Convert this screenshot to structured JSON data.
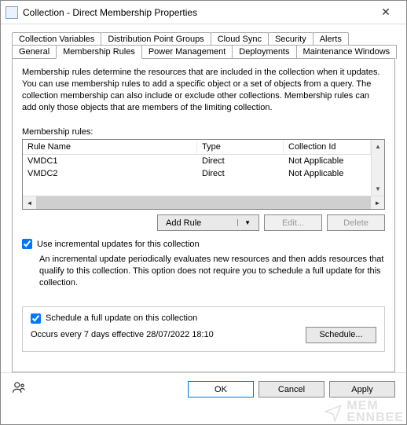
{
  "window": {
    "title": "Collection - Direct Membership Properties",
    "close_glyph": "✕"
  },
  "tabs_row1": [
    "Collection Variables",
    "Distribution Point Groups",
    "Cloud Sync",
    "Security",
    "Alerts"
  ],
  "tabs_row2": [
    "General",
    "Membership Rules",
    "Power Management",
    "Deployments",
    "Maintenance Windows"
  ],
  "tabs_active_row2_index": 1,
  "panel": {
    "description": "Membership rules determine the resources that are included in the collection when it updates. You can use membership rules to add a specific object or a set of objects from a query. The collection membership can also include or exclude other collections. Membership rules can add only those objects that are members of the limiting collection.",
    "rules_label": "Membership rules:",
    "columns": {
      "c1": "Rule Name",
      "c2": "Type",
      "c3": "Collection Id"
    },
    "rows": [
      {
        "name": "VMDC1",
        "type": "Direct",
        "coll": "Not Applicable"
      },
      {
        "name": "VMDC2",
        "type": "Direct",
        "coll": "Not Applicable"
      }
    ],
    "buttons": {
      "add_rule": "Add Rule",
      "edit": "Edit...",
      "delete": "Delete"
    },
    "incremental": {
      "label": "Use incremental updates for this collection",
      "desc": "An incremental update periodically evaluates new resources and then adds resources that qualify to this collection. This option does not require you to schedule a full update for this collection."
    },
    "schedule": {
      "label": "Schedule a full update on this collection",
      "occurs": "Occurs every 7 days effective 28/07/2022 18:10",
      "button": "Schedule..."
    }
  },
  "footer": {
    "ok": "OK",
    "cancel": "Cancel",
    "apply": "Apply"
  },
  "watermark": {
    "l1": "MEM",
    "l2": "ENNBEE"
  }
}
